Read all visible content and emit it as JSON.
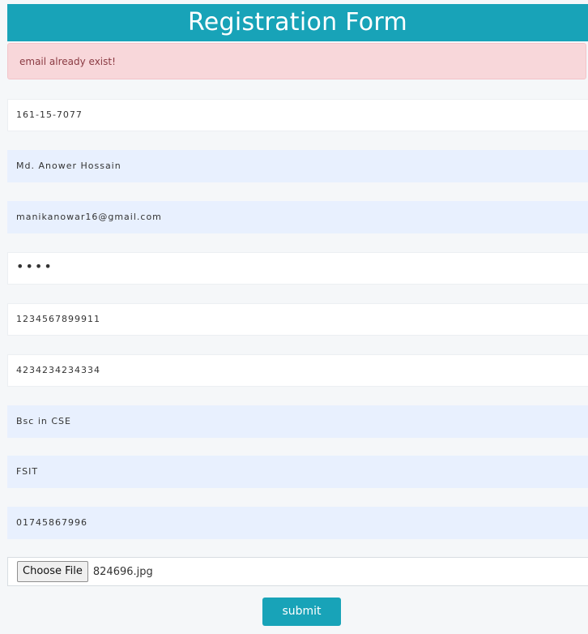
{
  "header": {
    "title": "Registration Form"
  },
  "alert": {
    "message": "email already exist!"
  },
  "fields": {
    "student_id": "161-15-7077",
    "name": "Md. Anower Hossain",
    "email": "manikanowar16@gmail.com",
    "password_mask": "••••",
    "field5": "1234567899911",
    "field6": "4234234234334",
    "program": "Bsc in CSE",
    "faculty": "FSIT",
    "phone": "01745867996"
  },
  "file_input": {
    "button_label": "Choose File",
    "file_name": "824696.jpg"
  },
  "submit": {
    "label": "submit"
  },
  "colors": {
    "accent": "#18a3b8",
    "alert_bg": "#f8d7da",
    "alert_text": "#8a3a42",
    "autofill_bg": "#e8f0fe"
  }
}
